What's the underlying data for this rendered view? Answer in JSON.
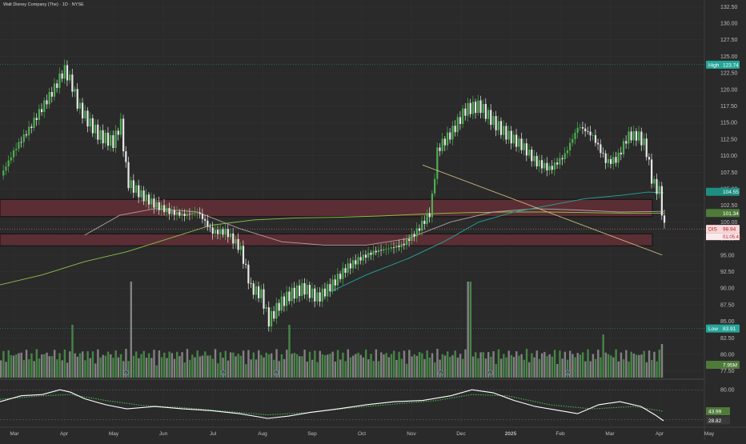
{
  "header": {
    "title": "Walt Disney Company (The) · 1D · NYSE"
  },
  "colors": {
    "background": "#2a2a2a",
    "grid": "#333333",
    "up": "#4caf50",
    "down": "#e8e8e8",
    "zone": "#5a2e34",
    "ma_short": "#26a69a",
    "ma_long": "#8bc34a",
    "ma_mid": "#b0a0a0",
    "trendline": "#d4c78a",
    "volume_up": "#4a8f4a",
    "volume_down": "#8c8c8c",
    "osc_main": "#ffffff",
    "osc_signal": "#4caf50",
    "high_tag": "#26a69a",
    "price_tag": "#f8d7da"
  },
  "chart_data": {
    "type": "candlestick",
    "symbol": "DIS",
    "price_axis": {
      "ticks": [
        "132.50",
        "130.00",
        "127.50",
        "125.00",
        "122.50",
        "120.00",
        "117.50",
        "115.00",
        "112.50",
        "110.00",
        "107.50",
        "105.00",
        "102.50",
        "100.00",
        "97.50",
        "95.00",
        "92.50",
        "90.00",
        "87.50",
        "85.00",
        "82.50",
        "80.00",
        "77.50"
      ],
      "min": 76.5,
      "max": 133.5
    },
    "x_axis": {
      "ticks": [
        "Mar",
        "Apr",
        "May",
        "Jun",
        "Jul",
        "Aug",
        "Sep",
        "Oct",
        "Nov",
        "Dec",
        "2025",
        "Feb",
        "Mar",
        "Apr",
        "May"
      ]
    },
    "labels": {
      "high_label": "High",
      "high_value": "123.74",
      "low_label": "Low",
      "low_value": "83.91",
      "ma1_value": "104.55",
      "ma2_value": "101.34",
      "price_symbol": "DIS",
      "price_value": "98.94",
      "countdown": "01:05:41",
      "volume_value": "7.95M"
    },
    "levels": {
      "high": 123.74,
      "low": 83.91,
      "ma1": 104.55,
      "ma2": 101.34,
      "last": 98.94
    },
    "zones": [
      {
        "from": 100.8,
        "to": 103.4
      },
      {
        "from": 96.4,
        "to": 98.2
      }
    ],
    "trendline": {
      "x0": 0.6,
      "y0": 108.6,
      "x1": 0.94,
      "y1": 95.0
    },
    "price_path": [
      [
        0.0,
        107.0
      ],
      [
        0.02,
        111.0
      ],
      [
        0.04,
        114.0
      ],
      [
        0.06,
        117.5
      ],
      [
        0.075,
        120.0
      ],
      [
        0.09,
        123.0
      ],
      [
        0.1,
        121.0
      ],
      [
        0.11,
        117.5
      ],
      [
        0.125,
        115.0
      ],
      [
        0.14,
        113.0
      ],
      [
        0.16,
        112.0
      ],
      [
        0.17,
        115.0
      ],
      [
        0.18,
        106.0
      ],
      [
        0.2,
        104.0
      ],
      [
        0.22,
        102.5
      ],
      [
        0.24,
        101.5
      ],
      [
        0.26,
        101.0
      ],
      [
        0.28,
        101.5
      ],
      [
        0.3,
        98.5
      ],
      [
        0.32,
        98.5
      ],
      [
        0.34,
        96.0
      ],
      [
        0.355,
        90.0
      ],
      [
        0.37,
        89.0
      ],
      [
        0.38,
        85.0
      ],
      [
        0.395,
        87.5
      ],
      [
        0.41,
        89.0
      ],
      [
        0.43,
        90.0
      ],
      [
        0.45,
        88.5
      ],
      [
        0.47,
        90.5
      ],
      [
        0.49,
        93.0
      ],
      [
        0.51,
        94.5
      ],
      [
        0.53,
        95.5
      ],
      [
        0.55,
        96.0
      ],
      [
        0.57,
        96.5
      ],
      [
        0.59,
        98.5
      ],
      [
        0.61,
        101.5
      ],
      [
        0.62,
        111.0
      ],
      [
        0.64,
        113.5
      ],
      [
        0.66,
        117.0
      ],
      [
        0.68,
        117.5
      ],
      [
        0.7,
        115.0
      ],
      [
        0.72,
        113.0
      ],
      [
        0.74,
        111.5
      ],
      [
        0.76,
        109.0
      ],
      [
        0.78,
        108.0
      ],
      [
        0.8,
        110.0
      ],
      [
        0.82,
        114.5
      ],
      [
        0.84,
        113.0
      ],
      [
        0.86,
        109.0
      ],
      [
        0.875,
        109.5
      ],
      [
        0.89,
        113.0
      ],
      [
        0.905,
        113.0
      ],
      [
        0.915,
        111.5
      ],
      [
        0.925,
        106.0
      ],
      [
        0.935,
        104.5
      ],
      [
        0.942,
        99.0
      ]
    ],
    "ma_short": [
      [
        0.47,
        89.5
      ],
      [
        0.52,
        92.0
      ],
      [
        0.58,
        94.5
      ],
      [
        0.63,
        97.0
      ],
      [
        0.68,
        100.0
      ],
      [
        0.73,
        101.5
      ],
      [
        0.78,
        102.5
      ],
      [
        0.83,
        103.5
      ],
      [
        0.88,
        104.0
      ],
      [
        0.92,
        104.5
      ],
      [
        0.942,
        104.4
      ]
    ],
    "ma_long": [
      [
        0.0,
        90.5
      ],
      [
        0.06,
        92.0
      ],
      [
        0.12,
        94.0
      ],
      [
        0.18,
        95.5
      ],
      [
        0.24,
        97.5
      ],
      [
        0.3,
        99.5
      ],
      [
        0.36,
        100.3
      ],
      [
        0.42,
        100.6
      ],
      [
        0.48,
        100.7
      ],
      [
        0.54,
        100.9
      ],
      [
        0.6,
        101.2
      ],
      [
        0.66,
        101.4
      ],
      [
        0.72,
        101.5
      ],
      [
        0.78,
        101.5
      ],
      [
        0.84,
        101.4
      ],
      [
        0.9,
        101.3
      ],
      [
        0.942,
        101.3
      ]
    ],
    "ma_mid": [
      [
        0.12,
        98.0
      ],
      [
        0.17,
        101.0
      ],
      [
        0.22,
        102.0
      ],
      [
        0.28,
        101.5
      ],
      [
        0.34,
        99.0
      ],
      [
        0.4,
        97.0
      ],
      [
        0.46,
        96.5
      ],
      [
        0.52,
        96.5
      ],
      [
        0.58,
        97.5
      ],
      [
        0.64,
        100.0
      ],
      [
        0.7,
        101.5
      ],
      [
        0.76,
        102.0
      ],
      [
        0.82,
        101.8
      ],
      [
        0.88,
        101.5
      ],
      [
        0.942,
        101.6
      ]
    ],
    "volume_spikes": [
      {
        "x": 0.186,
        "v": 1.0
      },
      {
        "x": 0.665,
        "v": 1.0
      },
      {
        "x": 0.1,
        "v": 0.55
      },
      {
        "x": 0.41,
        "v": 0.55
      },
      {
        "x": 0.855,
        "v": 0.45
      },
      {
        "x": 0.94,
        "v": 0.35
      }
    ],
    "oscillator": {
      "ticks": [
        "80.00"
      ],
      "min": 20,
      "max": 95,
      "main_value": "43.99",
      "signal_value": "28.82",
      "main": [
        [
          0.0,
          60
        ],
        [
          0.03,
          70
        ],
        [
          0.06,
          72
        ],
        [
          0.085,
          80
        ],
        [
          0.1,
          76
        ],
        [
          0.12,
          65
        ],
        [
          0.15,
          55
        ],
        [
          0.18,
          48
        ],
        [
          0.22,
          52
        ],
        [
          0.26,
          48
        ],
        [
          0.3,
          45
        ],
        [
          0.34,
          40
        ],
        [
          0.38,
          32
        ],
        [
          0.41,
          36
        ],
        [
          0.44,
          42
        ],
        [
          0.48,
          48
        ],
        [
          0.52,
          55
        ],
        [
          0.56,
          60
        ],
        [
          0.6,
          62
        ],
        [
          0.64,
          70
        ],
        [
          0.67,
          80
        ],
        [
          0.7,
          75
        ],
        [
          0.73,
          62
        ],
        [
          0.76,
          52
        ],
        [
          0.79,
          46
        ],
        [
          0.82,
          40
        ],
        [
          0.85,
          55
        ],
        [
          0.88,
          60
        ],
        [
          0.91,
          52
        ],
        [
          0.93,
          38
        ],
        [
          0.942,
          28
        ]
      ],
      "signal": [
        [
          0.0,
          64
        ],
        [
          0.06,
          70
        ],
        [
          0.1,
          72
        ],
        [
          0.15,
          62
        ],
        [
          0.2,
          54
        ],
        [
          0.26,
          50
        ],
        [
          0.32,
          44
        ],
        [
          0.38,
          38
        ],
        [
          0.44,
          42
        ],
        [
          0.5,
          50
        ],
        [
          0.56,
          56
        ],
        [
          0.62,
          62
        ],
        [
          0.67,
          72
        ],
        [
          0.72,
          70
        ],
        [
          0.78,
          55
        ],
        [
          0.84,
          48
        ],
        [
          0.9,
          52
        ],
        [
          0.942,
          44
        ]
      ]
    },
    "axis_markers": [
      "E",
      "D",
      "D",
      "E",
      "E",
      "D",
      "E"
    ]
  }
}
